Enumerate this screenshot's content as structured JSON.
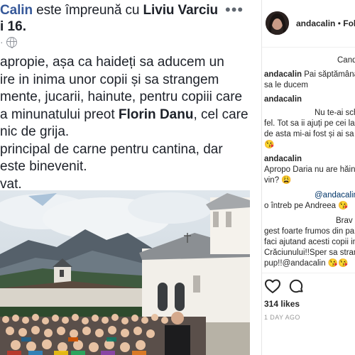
{
  "facebook": {
    "author": "Calin",
    "with_word": "este împreună cu",
    "with_name": "Liviu Varciu",
    "sub_prefix": "",
    "sub_bold": "i 16.",
    "meta_dot": "·",
    "more_label": "•••",
    "lines": [
      {
        "a": "apropie, așa ca haideți sa aducem un",
        "b": "",
        "c": ""
      },
      {
        "a": "ire in inima unor copii și sa strangem",
        "b": "",
        "c": ""
      },
      {
        "a": "mente, jucarii, hainute, pentru copiii care",
        "b": "",
        "c": ""
      },
      {
        "a": "a minunatului preot ",
        "b": "Florin Danu",
        "c": ", cel care"
      },
      {
        "a": "nic de grija.",
        "b": "",
        "c": ""
      },
      {
        "a": "principal de carne pentru cantina, dar",
        "b": "",
        "c": ""
      },
      {
        "a": "este binevenit.",
        "b": "",
        "c": ""
      },
      {
        "a": "vat.",
        "b": "",
        "c": ""
      }
    ]
  },
  "instagram": {
    "username": "andacalin",
    "dot": "•",
    "follow": "Follo",
    "comments": {
      "c1_text": "Cand",
      "c2_user": "andacalin",
      "c2_text": "Pai săptămâna",
      "c2_text2": "sa le ducem",
      "c3_user": "andacalin",
      "c3_text": "Nu te-ai sch",
      "c3_text2": "fel. Tot sa ii ajuți pe cei la",
      "c3_text3": "de asta mi-ai fost și ai sa",
      "c3_emoji": "😘",
      "c4_user": "andacalin",
      "c4_text": "Apropo Daria nu are hăin",
      "c4_text2": "vin? 😩",
      "c5_mention": "@andacalin",
      "c5_text": "o întreb pe Andreea 😘",
      "c6_text": "Brav",
      "c6_text2": "gest foarte frumos din pa",
      "c6_text3": "faci ajutand acesti copii in",
      "c6_text4": "Crăciunului!!Sper sa stran",
      "c6_text5": "pup!!@andacalin 😘😘"
    },
    "likes": "314 likes",
    "time_ago": "1 DAY AGO",
    "icons": {
      "like": "heart-icon",
      "comment": "comment-icon"
    }
  },
  "colors": {
    "fb_link": "#365899",
    "fb_text": "#1d2129",
    "ig_text": "#262626",
    "ig_meta": "#999999"
  }
}
